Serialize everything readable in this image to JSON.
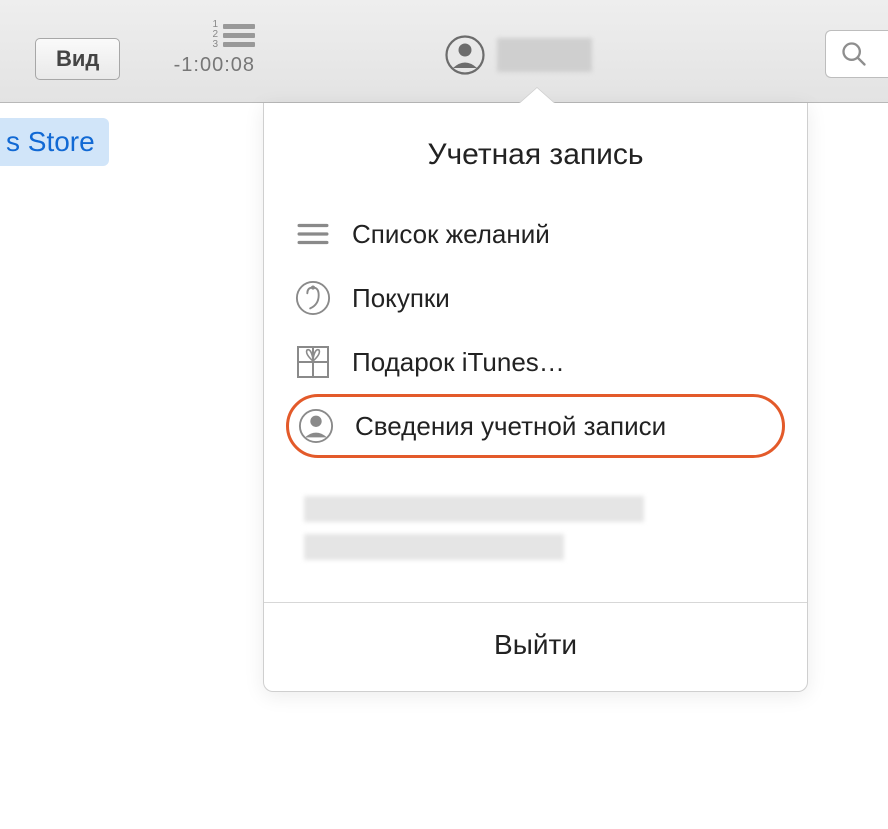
{
  "toolbar": {
    "view_button_label": "Вид",
    "time_remaining": "-1:00:08"
  },
  "sidebar": {
    "store_label": "s Store"
  },
  "dropdown": {
    "title": "Учетная запись",
    "items": [
      {
        "label": "Список желаний",
        "icon": "list-icon"
      },
      {
        "label": "Покупки",
        "icon": "bag-icon"
      },
      {
        "label": "Подарок iTunes…",
        "icon": "gift-icon"
      },
      {
        "label": "Сведения учетной записи",
        "icon": "person-icon"
      }
    ],
    "signout_label": "Выйти"
  }
}
